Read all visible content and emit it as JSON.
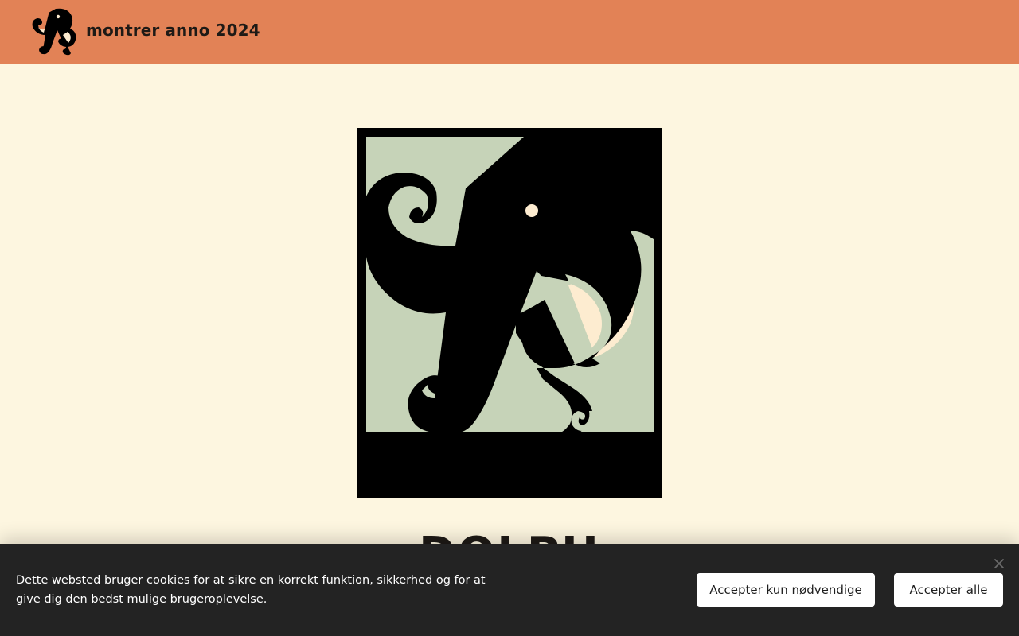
{
  "header": {
    "site_title": "montrer anno 2024",
    "logo_icon": "elephant-logo-icon",
    "background_color": "#e28256"
  },
  "main": {
    "hero_image_icon": "elephant-logo-icon",
    "hero_heading": "DOLPH",
    "background_color": "#fdf6e0",
    "logo_colors": {
      "frame": "#000000",
      "panel": "#c6d3b8",
      "tusk": "#fdecd0"
    }
  },
  "cookie_banner": {
    "message": "Dette websted bruger cookies for at sikre en korrekt funktion, sikkerhed og for at give dig den bedst mulige brugeroplevelse.",
    "accept_necessary_label": "Accepter kun nødvendige",
    "accept_all_label": "Accepter alle",
    "close_icon": "close-icon",
    "background_color": "#232323"
  }
}
